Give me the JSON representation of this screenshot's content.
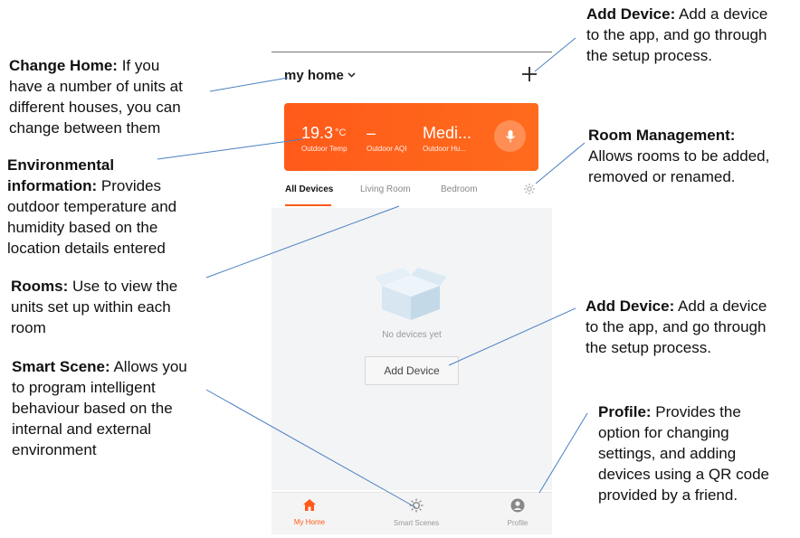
{
  "annotations": {
    "add_device_top": {
      "title": "Add Device:",
      "lines": [
        "Add a device",
        "to the app, and go through",
        "the setup process."
      ]
    },
    "change_home": {
      "title": "Change Home:",
      "lines": [
        "If you",
        "have a number of units at",
        "different houses, you can",
        "change between them"
      ]
    },
    "room_management": {
      "title": "Room Management:",
      "lines": [
        "Allows rooms to be added,",
        "removed or renamed."
      ]
    },
    "environmental": {
      "title_line1": "Environmental",
      "title_line2": "information:",
      "lines": [
        "Provides",
        "outdoor temperature and",
        "humidity based on the",
        "location details entered"
      ]
    },
    "rooms": {
      "title": "Rooms:",
      "lines": [
        "Use to view the",
        "units set up within each",
        "room"
      ]
    },
    "add_device_mid": {
      "title": "Add Device:",
      "lines": [
        "Add a device",
        "to the app, and go through",
        "the setup process."
      ]
    },
    "smart_scene": {
      "title": "Smart Scene:",
      "lines": [
        "Allows you",
        "to program intelligent",
        "behaviour based on the",
        "internal and external",
        "environment"
      ]
    },
    "profile": {
      "title": "Profile:",
      "lines": [
        "Provides the",
        "option for changing",
        "settings, and adding",
        "devices using a QR code",
        "provided by a friend."
      ]
    }
  },
  "app": {
    "home_name": "my home",
    "add_icon": "plus-icon",
    "env": {
      "temp_value": "19.3",
      "temp_unit": "°C",
      "temp_label": "Outdoor Temp",
      "aqi_value": "–",
      "aqi_label": "Outdoor AQI",
      "humidity_value": "Medi...",
      "humidity_label": "Outdoor Hu..."
    },
    "tabs": [
      "All Devices",
      "Living Room",
      "Bedroom"
    ],
    "active_tab": "All Devices",
    "empty_text": "No devices yet",
    "add_device_button": "Add Device",
    "nav": [
      {
        "label": "My Home",
        "icon": "home-icon",
        "active": true
      },
      {
        "label": "Smart Scenes",
        "icon": "sun-icon",
        "active": false
      },
      {
        "label": "Profile",
        "icon": "user-icon",
        "active": false
      }
    ],
    "colors": {
      "accent": "#ff5a1a",
      "leader_line": "#4a7fc1"
    }
  }
}
